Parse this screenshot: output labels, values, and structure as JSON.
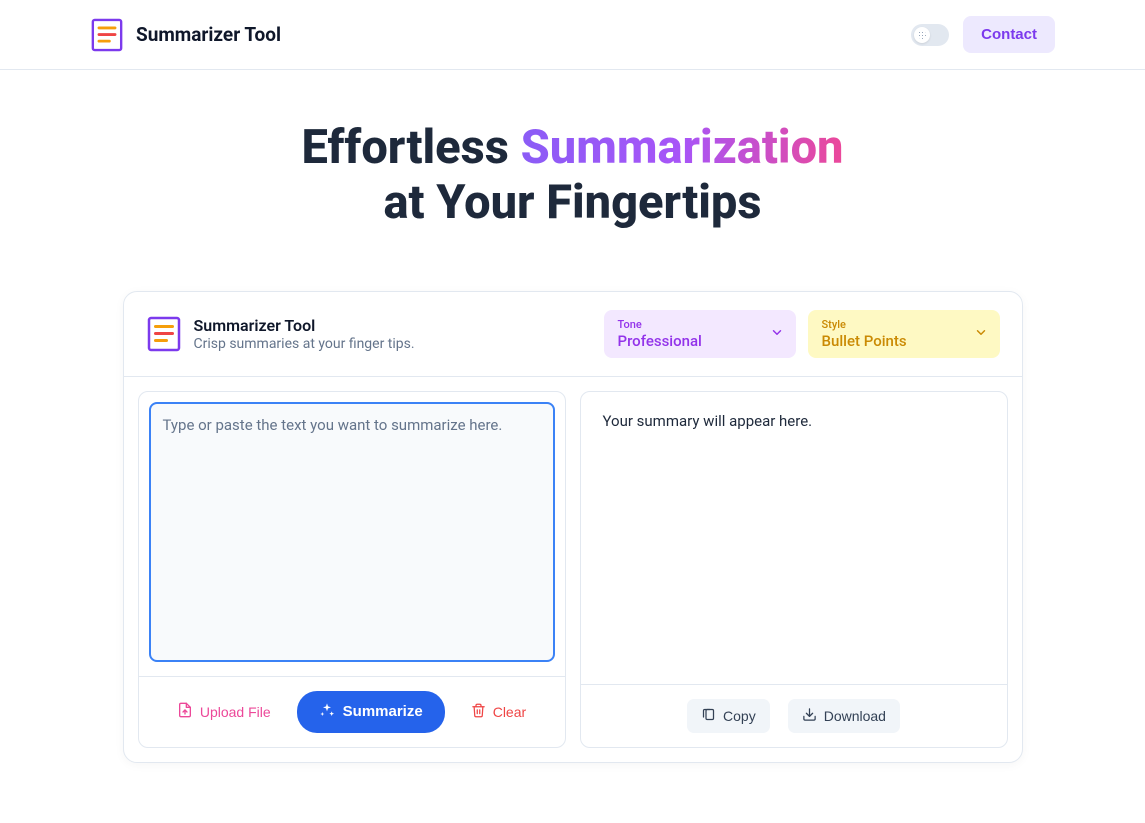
{
  "header": {
    "brand": "Summarizer Tool",
    "contact_label": "Contact"
  },
  "hero": {
    "line1_pre": "Effortless ",
    "line1_highlight": "Summarization",
    "line2": "at Your Fingertips"
  },
  "card": {
    "title": "Summarizer Tool",
    "subtitle": "Crisp summaries at your finger tips.",
    "tone": {
      "label": "Tone",
      "value": "Professional"
    },
    "style": {
      "label": "Style",
      "value": "Bullet Points"
    },
    "input_placeholder": "Type or paste the text you want to summarize here.",
    "output_placeholder": "Your summary will appear here.",
    "buttons": {
      "upload": "Upload File",
      "summarize": "Summarize",
      "clear": "Clear",
      "copy": "Copy",
      "download": "Download"
    }
  }
}
